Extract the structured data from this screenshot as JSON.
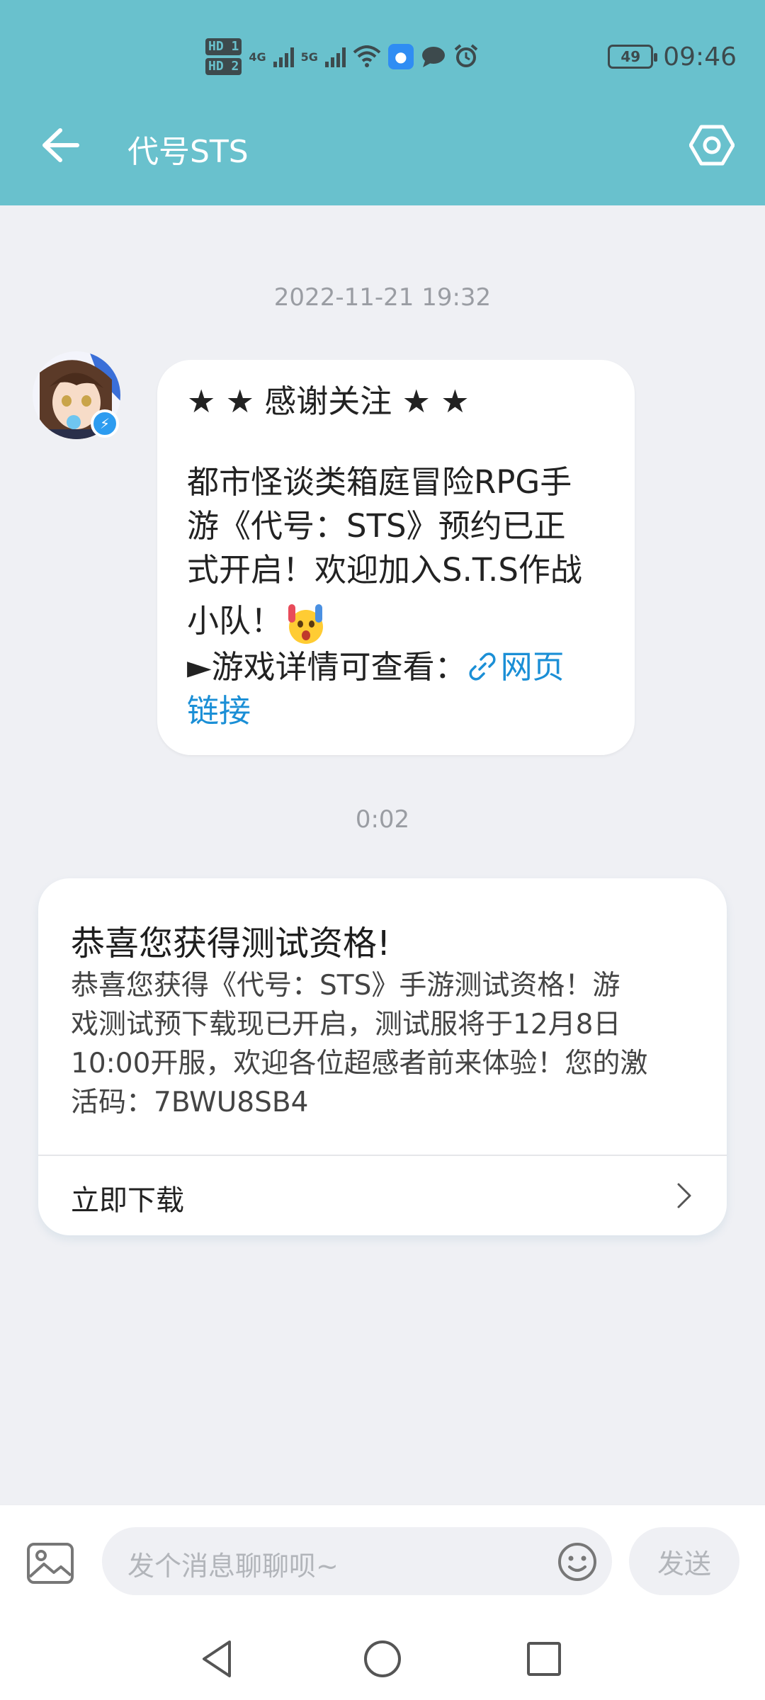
{
  "statusbar": {
    "sim1": "HD 1",
    "sim2": "HD 2",
    "net1": "4G",
    "net2": "5G",
    "battery": "49",
    "time": "09:46"
  },
  "header": {
    "title": "代号STS",
    "back_icon": "arrow-left-icon",
    "settings_icon": "settings-icon"
  },
  "chat": {
    "timestamp_1": "2022-11-21 19:32",
    "message": {
      "line_title": "★ ★ 感谢关注 ★ ★",
      "line_1": "都市怪谈类箱庭冒险RPG手",
      "line_2": "游《代号：STS》预约已正",
      "line_3": "式开启！欢迎加入S.T.S作战",
      "line_4": "小队！",
      "details_prefix": "►游戏详情可查看：",
      "link_part1": "网页",
      "link_part2": "链接"
    },
    "timestamp_2": "0:02",
    "card": {
      "title": "恭喜您获得测试资格!",
      "body_1": "恭喜您获得《代号：STS》手游测试资格！游",
      "body_2": "戏测试预下载现已开启，测试服将于12月8日",
      "body_3": "10:00开服，欢迎各位超感者前来体验！您的激",
      "body_4": "活码：7BWU8SB4",
      "action": "立即下载"
    }
  },
  "input": {
    "placeholder": "发个消息聊聊呗~",
    "send": "发送"
  },
  "colors": {
    "header": "#69c1cd",
    "background": "#eff0f4",
    "link": "#1b8fd6"
  }
}
